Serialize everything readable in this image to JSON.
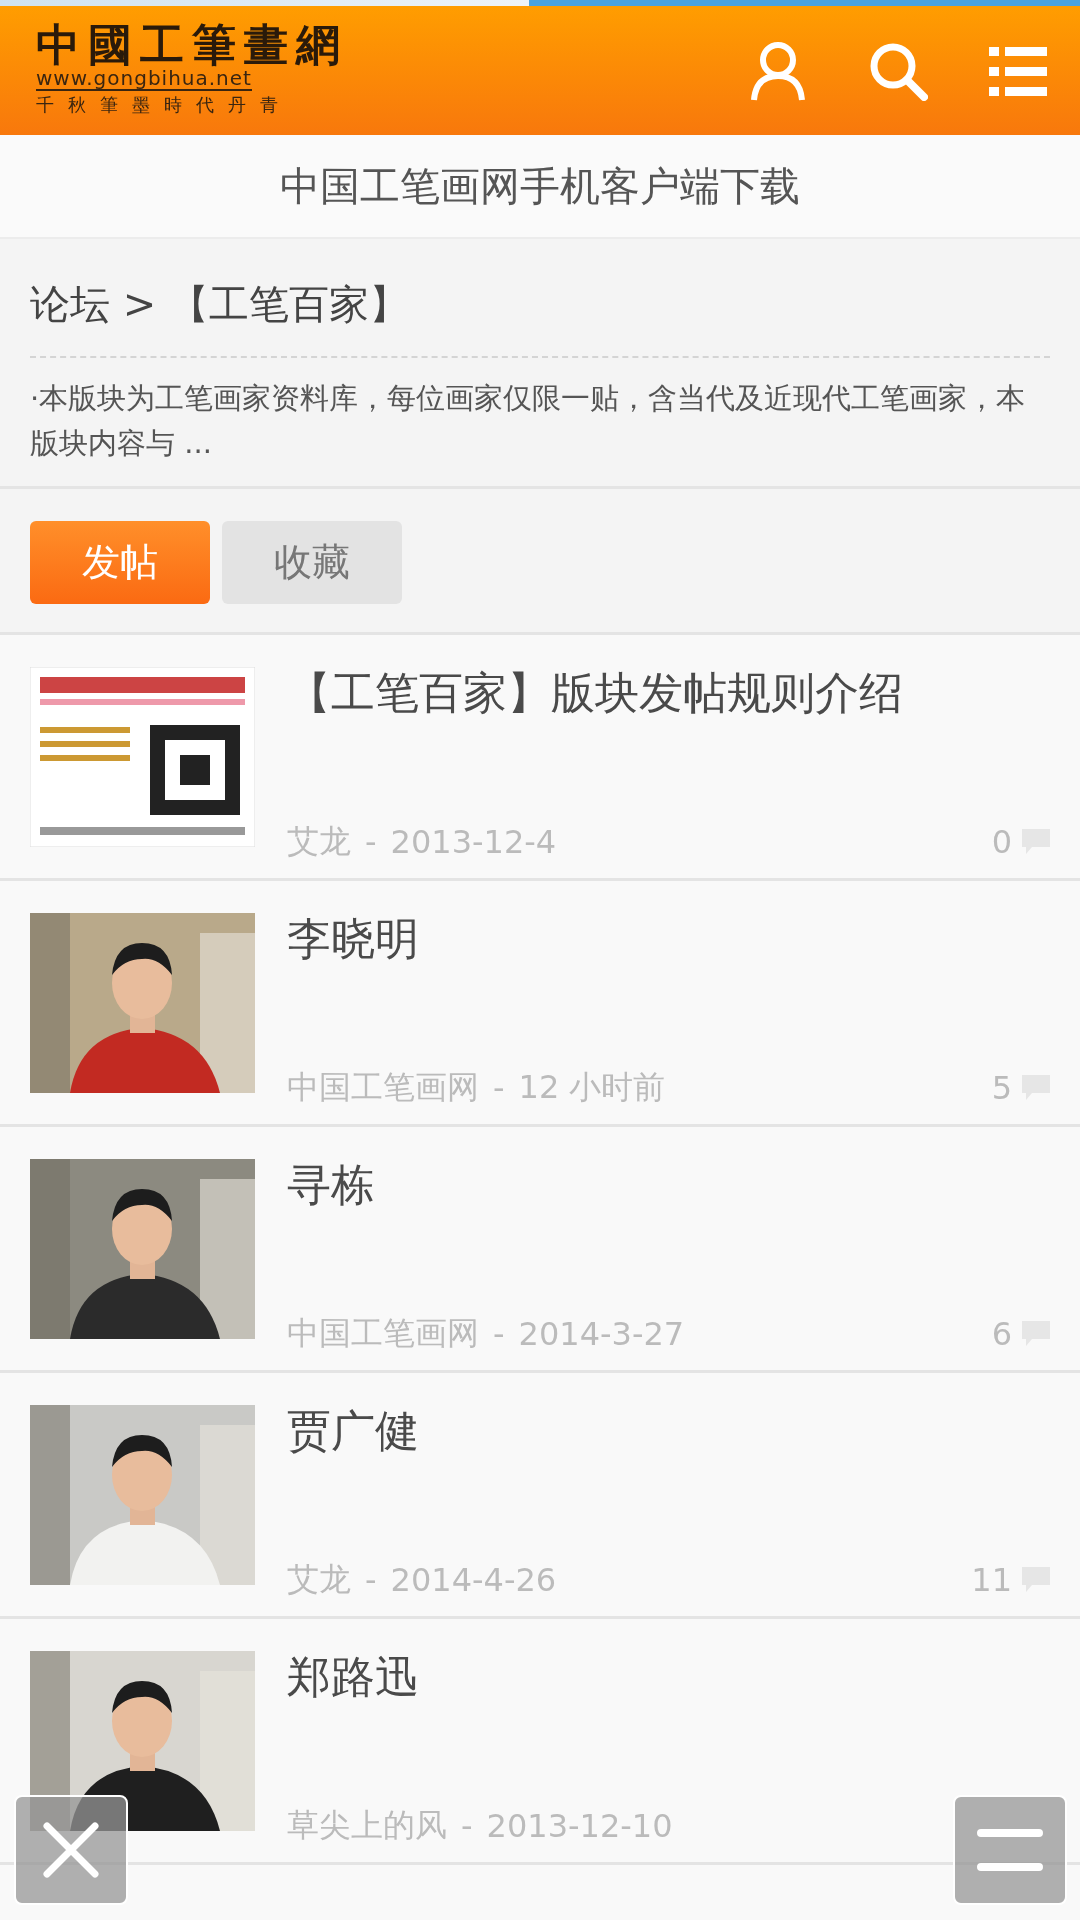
{
  "progress": {
    "level": 0.49
  },
  "header": {
    "logo": {
      "title": "中國工筆畫網",
      "url": "www.gongbihua.net",
      "motto": "千秋筆墨時代丹青"
    }
  },
  "download_banner": "中国工笔画网手机客户端下载",
  "forum": {
    "breadcrumb": "论坛 > 【工笔百家】",
    "description": "·本版块为工笔画家资料库，每位画家仅限一贴，含当代及近现代工笔画家，本版块内容与 ..."
  },
  "actions": [
    {
      "label": "发帖",
      "kind": "primary"
    },
    {
      "label": "收藏",
      "kind": "secondary"
    }
  ],
  "posts": [
    {
      "title": "【工笔百家】版块发帖规则介绍",
      "author": "艾龙",
      "separator": "-",
      "date": "2013-12-4",
      "replies": "0",
      "thumb": {
        "kind": "poster"
      }
    },
    {
      "title": "李晓明",
      "author": "中国工笔画网",
      "separator": "-",
      "date": "12 小时前",
      "replies": "5",
      "thumb": {
        "kind": "portrait"
      }
    },
    {
      "title": "寻栋",
      "author": "中国工笔画网",
      "separator": "-",
      "date": "2014-3-27",
      "replies": "6",
      "thumb": {
        "kind": "portrait"
      }
    },
    {
      "title": "贾广健",
      "author": "艾龙",
      "separator": "-",
      "date": "2014-4-26",
      "replies": "11",
      "thumb": {
        "kind": "portrait"
      }
    },
    {
      "title": "郑路迅",
      "author": "草尖上的风",
      "separator": "-",
      "date": "2013-12-10",
      "thumb": {
        "kind": "portrait"
      }
    }
  ]
}
